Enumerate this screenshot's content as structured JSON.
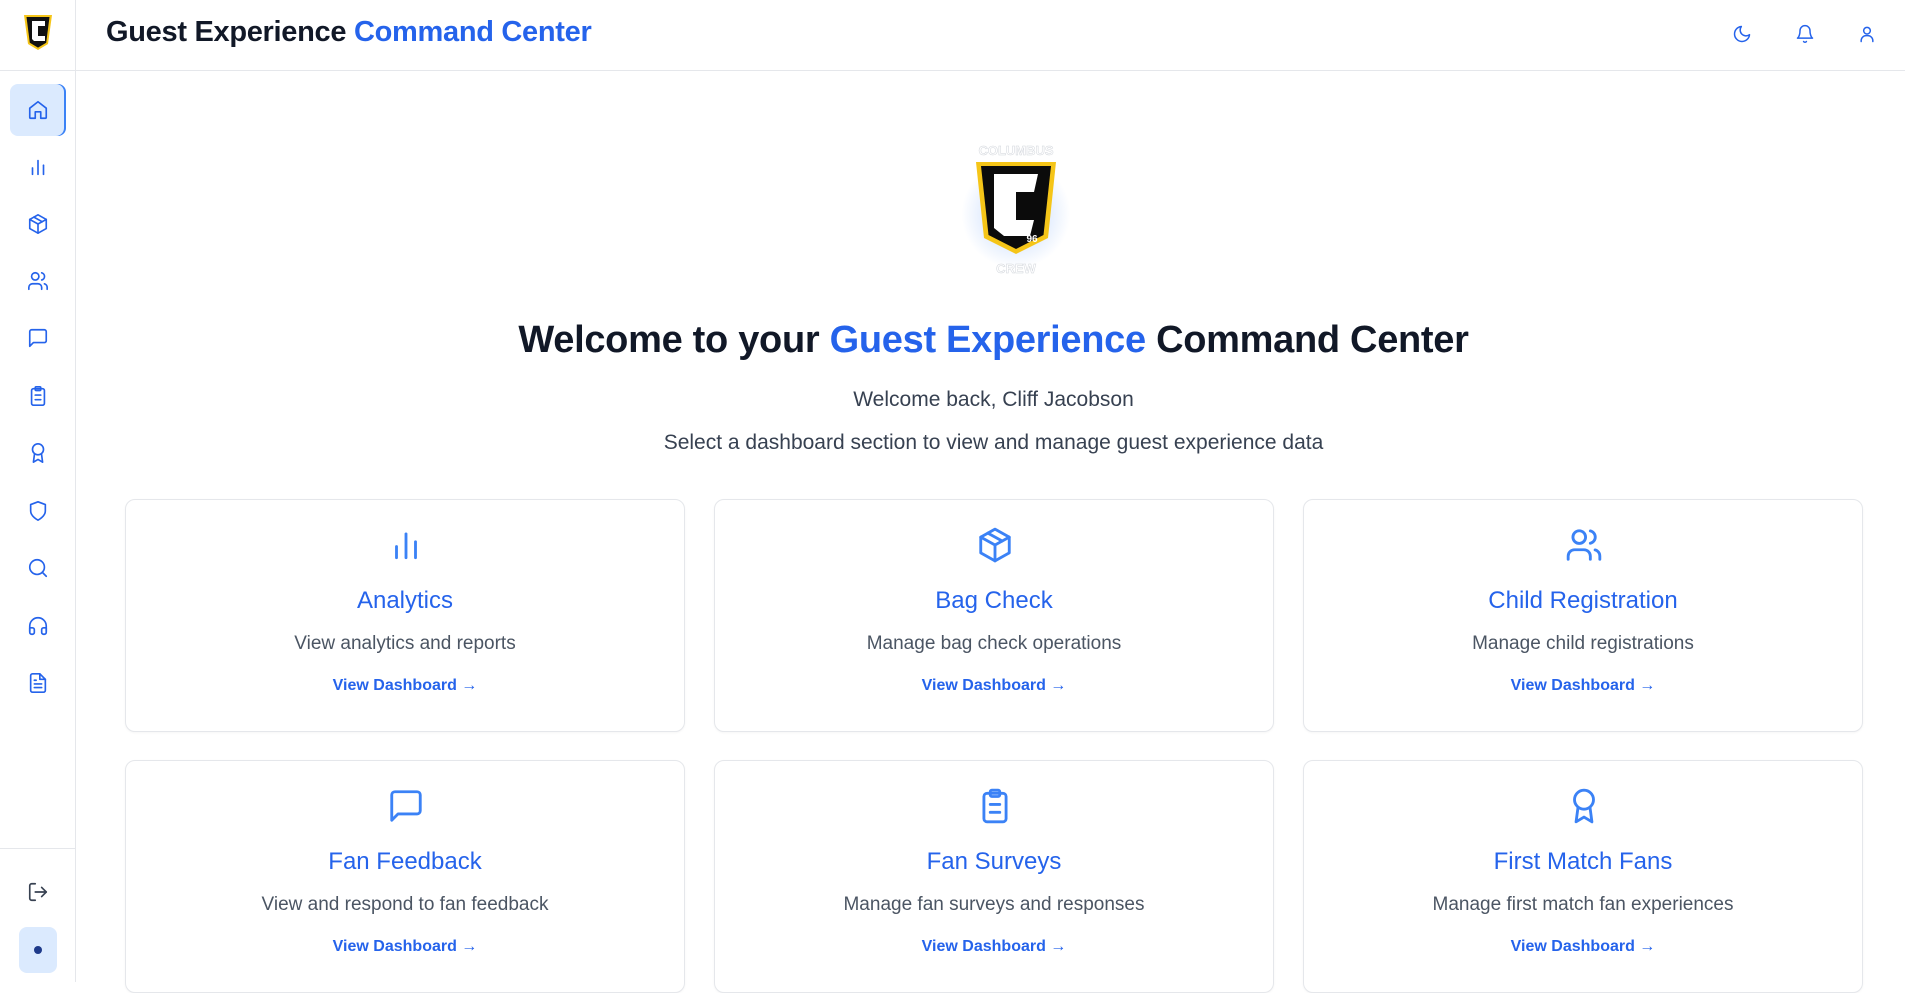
{
  "header": {
    "title_prefix": "Guest Experience",
    "title_accent": "Command Center",
    "icons": [
      "moon-icon",
      "bell-icon",
      "user-icon"
    ]
  },
  "sidebar": {
    "items": [
      {
        "name": "home",
        "icon": "home-icon",
        "active": true
      },
      {
        "name": "analytics",
        "icon": "bar-chart-icon"
      },
      {
        "name": "bag-check",
        "icon": "package-icon"
      },
      {
        "name": "child-registration",
        "icon": "users-icon"
      },
      {
        "name": "fan-feedback",
        "icon": "message-icon"
      },
      {
        "name": "fan-surveys",
        "icon": "clipboard-icon"
      },
      {
        "name": "first-match-fans",
        "icon": "award-icon"
      },
      {
        "name": "security",
        "icon": "shield-icon"
      },
      {
        "name": "search",
        "icon": "search-icon"
      },
      {
        "name": "support",
        "icon": "headphones-icon"
      },
      {
        "name": "documents",
        "icon": "file-text-icon"
      }
    ],
    "logout_icon": "logout-icon",
    "status_icon": "status-dot-icon"
  },
  "hero": {
    "heading_prefix": "Welcome to your ",
    "heading_accent": "Guest Experience",
    "heading_suffix": " Command Center",
    "user_line": "Welcome back, Cliff Jacobson",
    "subtitle": "Select a dashboard section to view and manage guest experience data",
    "logo_text_top": "COLUMBUS",
    "logo_text_bottom": "CREW",
    "logo_number": "96"
  },
  "cards": [
    {
      "title": "Analytics",
      "description": "View analytics and reports",
      "link": "View Dashboard →",
      "icon": "bar-chart-icon"
    },
    {
      "title": "Bag Check",
      "description": "Manage bag check operations",
      "link": "View Dashboard →",
      "icon": "package-icon"
    },
    {
      "title": "Child Registration",
      "description": "Manage child registrations",
      "link": "View Dashboard →",
      "icon": "users-icon"
    },
    {
      "title": "Fan Feedback",
      "description": "View and respond to fan feedback",
      "link": "View Dashboard →",
      "icon": "message-icon"
    },
    {
      "title": "Fan Surveys",
      "description": "Manage fan surveys and responses",
      "link": "View Dashboard →",
      "icon": "clipboard-icon"
    },
    {
      "title": "First Match Fans",
      "description": "Manage first match fan experiences",
      "link": "View Dashboard →",
      "icon": "award-icon"
    }
  ],
  "colors": {
    "accent": "#2563eb",
    "icon": "#3b82f6",
    "active_bg": "#dbeafe"
  }
}
